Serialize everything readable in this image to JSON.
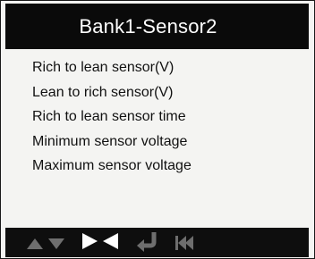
{
  "screen": {
    "title": "Bank1-Sensor2"
  },
  "menu": {
    "items": [
      {
        "label": "Rich to lean sensor(V)"
      },
      {
        "label": "Lean to rich sensor(V)"
      },
      {
        "label": "Rich to lean sensor time"
      },
      {
        "label": "Minimum sensor voltage"
      },
      {
        "label": "Maximum sensor voltage"
      }
    ]
  },
  "button_bar": {
    "buttons": [
      {
        "icon": "up-down-arrows-icon",
        "color": "#6e6e6e"
      },
      {
        "icon": "right-left-arrows-icon",
        "color": "#ffffff"
      },
      {
        "icon": "return-icon",
        "color": "#6e6e6e"
      },
      {
        "icon": "skip-back-icon",
        "color": "#6e6e6e"
      }
    ]
  },
  "colors": {
    "header_bg": "#0a0a0a",
    "header_text": "#ffffff",
    "screen_bg": "#f4f4f2",
    "text": "#111111",
    "button_bar_bg": "#0e0e0e",
    "icon_active": "#ffffff",
    "icon_inactive": "#6e6e6e"
  }
}
